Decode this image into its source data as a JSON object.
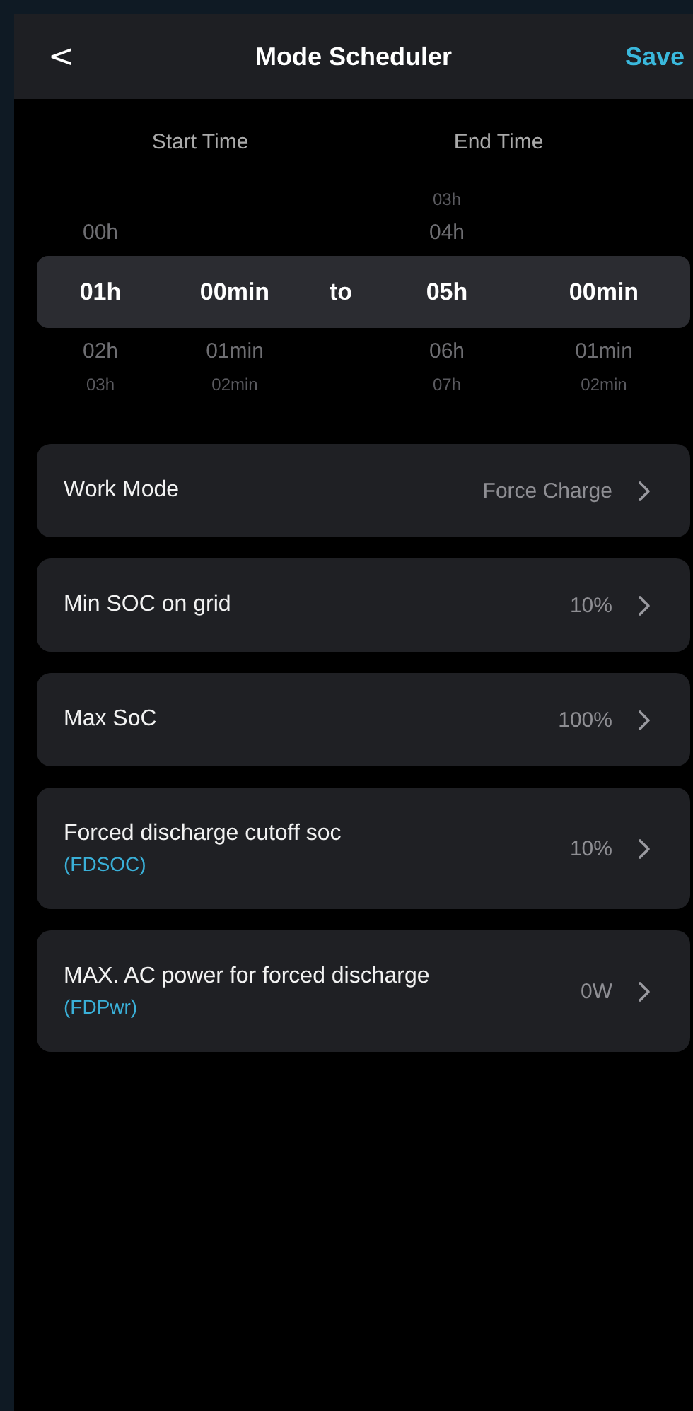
{
  "header": {
    "back": "<",
    "title": "Mode Scheduler",
    "action": "Save"
  },
  "picker": {
    "start_label": "Start Time",
    "end_label": "End Time",
    "separator": "to",
    "wheels": [
      {
        "above": [
          "00h"
        ],
        "selected": "01h",
        "below": [
          "02h",
          "03h"
        ]
      },
      {
        "selected": "00min",
        "below": [
          "01min",
          "02min"
        ]
      },
      {
        "above": [
          "03h",
          "04h"
        ],
        "selected": "05h",
        "below": [
          "06h",
          "07h"
        ]
      },
      {
        "selected": "00min",
        "below": [
          "01min",
          "02min"
        ]
      }
    ]
  },
  "settings": [
    {
      "label": "Work Mode",
      "value": "Force Charge"
    },
    {
      "label": "Min SOC on grid",
      "value": "10%"
    },
    {
      "label": "Max SoC",
      "value": "100%"
    },
    {
      "label": "Forced discharge cutoff soc",
      "sub": "(FDSOC)",
      "value": "10%"
    },
    {
      "label": "MAX. AC power for forced discharge",
      "sub": "(FDPwr)",
      "value": "0W"
    }
  ]
}
